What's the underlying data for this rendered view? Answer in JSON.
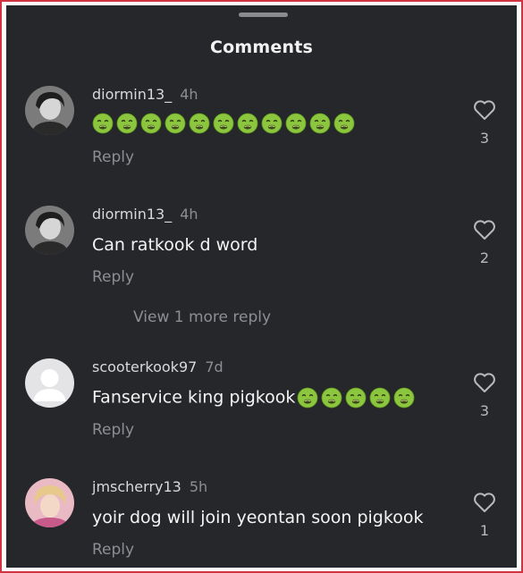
{
  "header": {
    "title": "Comments"
  },
  "colors": {
    "background": "#26272b",
    "text": "#f4f4f4",
    "muted": "#8d8e93",
    "frame": "#d0353f"
  },
  "comments": [
    {
      "username": "diormin13_",
      "time": "4h",
      "emoji": "nauseated-face",
      "emoji_count": 11,
      "reply_label": "Reply",
      "likes": "3",
      "avatar": "photo-dark-haired-person"
    },
    {
      "username": "diormin13_",
      "time": "4h",
      "text": "Can ratkook d word",
      "reply_label": "Reply",
      "likes": "2",
      "avatar": "photo-dark-haired-person"
    },
    {
      "username": "scooterkook97",
      "time": "7d",
      "text": "Fanservice king pigkook",
      "emoji": "nauseated-face",
      "emoji_count": 5,
      "reply_label": "Reply",
      "likes": "3",
      "avatar": "default-avatar"
    },
    {
      "username": "jmscherry13",
      "time": "5h",
      "text": "yoir dog will join yeontan soon pigkook",
      "reply_label": "Reply",
      "likes": "1",
      "avatar": "photo-blond-person"
    }
  ],
  "view_more": {
    "label": "View 1 more reply"
  }
}
